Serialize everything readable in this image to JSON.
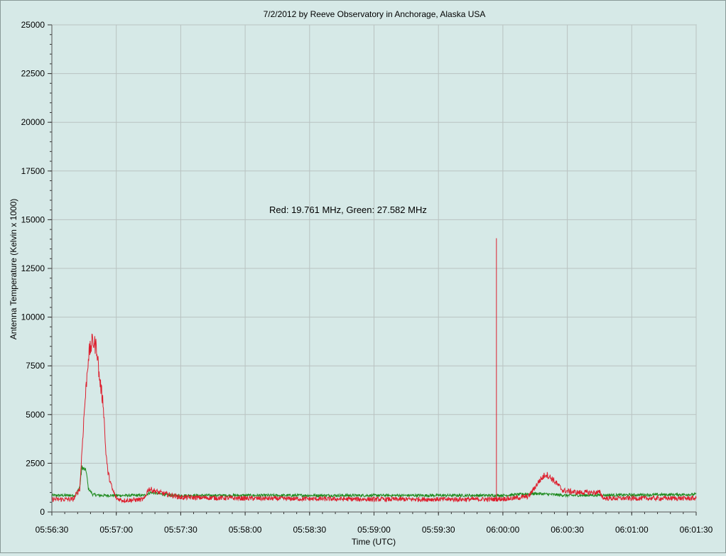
{
  "chart_data": {
    "type": "line",
    "title": "7/2/2012  by  Reeve Observatory  in  Anchorage, Alaska  USA",
    "annotation": "Red: 19.761 MHz, Green: 27.582 MHz",
    "xlabel": "Time (UTC)",
    "ylabel": "Antenna Temperature (Kelvin x 1000)",
    "x_ticks": [
      "05:56:30",
      "05:57:00",
      "05:57:30",
      "05:58:00",
      "05:58:30",
      "05:59:00",
      "05:59:30",
      "06:00:00",
      "06:00:30",
      "06:01:00",
      "06:01:30"
    ],
    "x_range": [
      "05:56:30",
      "06:01:30"
    ],
    "y_ticks": [
      0,
      2500,
      5000,
      7500,
      10000,
      12500,
      15000,
      17500,
      20000,
      22500,
      25000
    ],
    "ylim": [
      0,
      25000
    ],
    "grid": true,
    "colors": {
      "red": "#dd1f2e",
      "green": "#1e8a1e",
      "grid": "#b9c2c1",
      "plot_bg": "#d6e9e7"
    },
    "series": [
      {
        "color": "#dd1f2e",
        "noise": 180,
        "x": [
          "05:56:30",
          "05:56:40",
          "05:56:43",
          "05:56:45",
          "05:56:47",
          "05:56:49",
          "05:56:51",
          "05:56:52",
          "05:56:54",
          "05:56:55",
          "05:56:56",
          "05:56:58",
          "05:57:00",
          "05:57:03",
          "05:57:05",
          "05:57:13",
          "05:57:15",
          "05:57:20",
          "05:57:30",
          "05:58:00",
          "05:59:00",
          "05:59:55",
          "06:00:05",
          "06:00:12",
          "06:00:17",
          "06:00:20",
          "06:00:23",
          "06:00:28",
          "06:00:35",
          "06:00:45",
          "06:00:47",
          "06:01:30"
        ],
        "y": [
          650,
          650,
          1200,
          5000,
          8000,
          8800,
          8400,
          7000,
          5500,
          3300,
          2100,
          1200,
          700,
          600,
          600,
          650,
          1200,
          1000,
          750,
          700,
          650,
          650,
          700,
          800,
          1600,
          1950,
          1700,
          1100,
          1000,
          1000,
          700,
          700
        ]
      },
      {
        "color": "#1e8a1e",
        "noise": 100,
        "x": [
          "05:56:30",
          "05:56:41",
          "05:56:43",
          "05:56:44",
          "05:56:45",
          "05:56:46",
          "05:56:47",
          "05:56:49",
          "05:56:52",
          "05:57:00",
          "05:57:13",
          "05:57:16",
          "05:57:25",
          "06:00:00",
          "06:00:15",
          "06:00:30",
          "06:01:30"
        ],
        "y": [
          850,
          850,
          1300,
          2300,
          2200,
          2100,
          1200,
          900,
          850,
          850,
          850,
          1000,
          850,
          850,
          950,
          850,
          900
        ]
      }
    ],
    "spike": {
      "color": "#dd1f2e",
      "x": "05:59:57",
      "y": 14050
    }
  }
}
